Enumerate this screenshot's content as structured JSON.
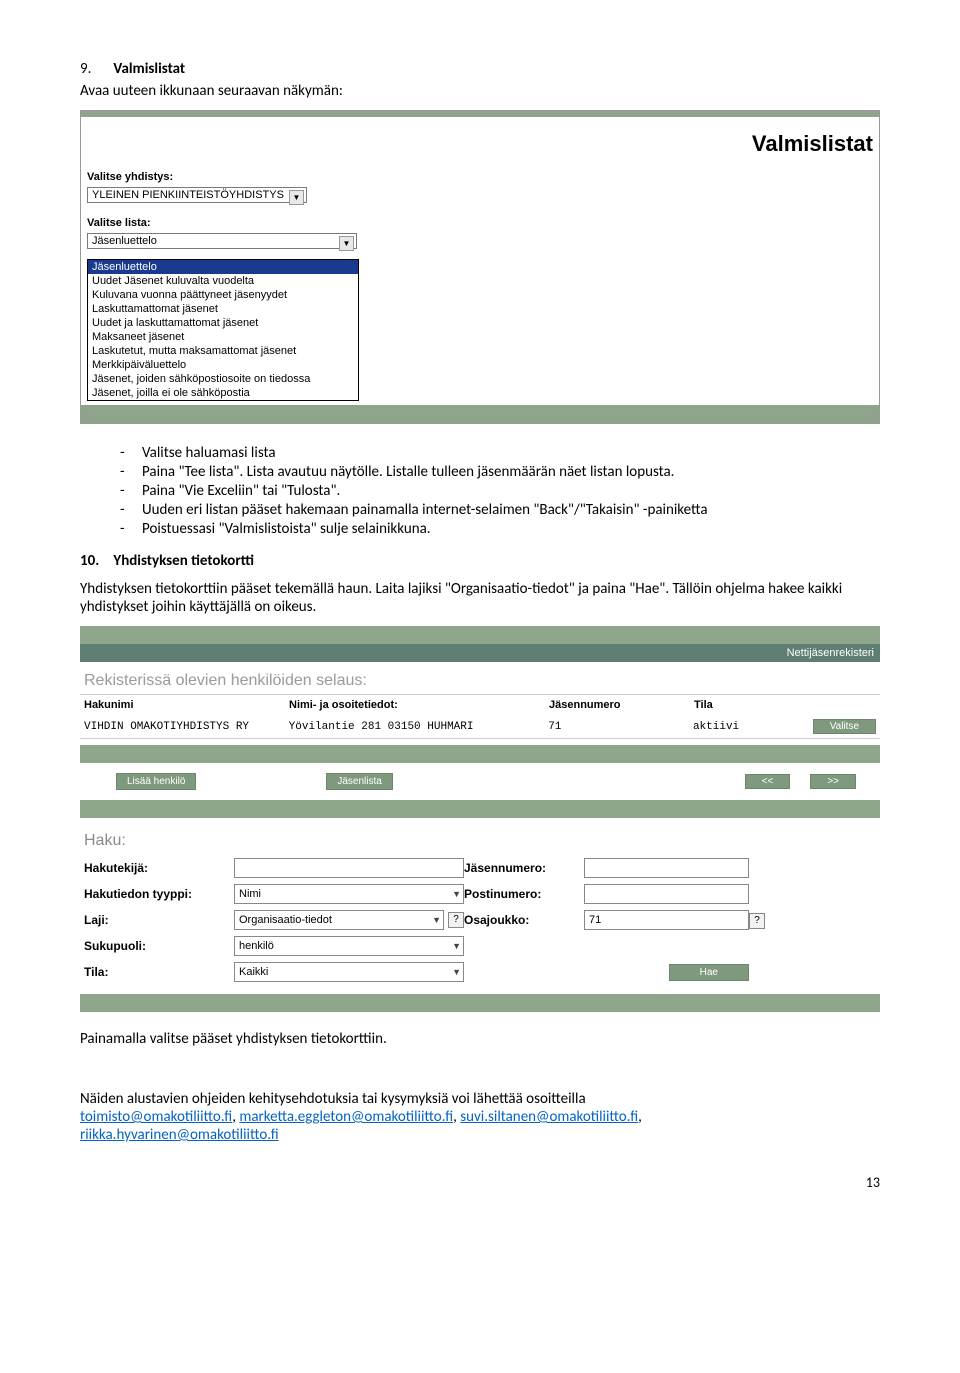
{
  "section9": {
    "number": "9.",
    "title": "Valmislistat",
    "intro": "Avaa uuteen ikkunaan seuraavan näkymän:"
  },
  "shot1": {
    "title": "Valmislistat",
    "label_yhdistys": "Valitse yhdistys:",
    "yhdistys_value": "YLEINEN PIENKIINTEISTÖYHDISTYS",
    "label_lista": "Valitse lista:",
    "lista_value": "Jäsenluettelo",
    "options": [
      "Jäsenluettelo",
      "Uudet Jäsenet kuluvalta vuodelta",
      "Kuluvana vuonna päättyneet jäsenyydet",
      "Laskuttamattomat jäsenet",
      "Uudet ja laskuttamattomat jäsenet",
      "Maksaneet jäsenet",
      "Laskutetut, mutta maksamattomat jäsenet",
      "Merkkipäiväluettelo",
      "Jäsenet, joiden sähköpostiosoite on tiedossa",
      "Jäsenet, joilla ei ole sähköpostia"
    ]
  },
  "bullets9": [
    "Valitse haluamasi lista",
    "Paina \"Tee lista\". Lista avautuu näytölle. Listalle tulleen jäsenmäärän näet listan lopusta.",
    "Paina \"Vie Exceliin\" tai \"Tulosta\".",
    "Uuden eri listan pääset hakemaan painamalla internet-selaimen \"Back\"/\"Takaisin\" -painiketta",
    "Poistuessasi \"Valmislistoista\" sulje selainikkuna."
  ],
  "section10": {
    "number": "10.",
    "title": "Yhdistyksen tietokortti",
    "para": "Yhdistyksen tietokorttiin pääset tekemällä haun. Laita lajiksi \"Organisaatio-tiedot\" ja paina \"Hae\". Tällöin ohjelma hakee kaikki yhdistykset joihin käyttäjällä on oikeus."
  },
  "shot2": {
    "topright": "Nettijäsenrekisteri",
    "section_title": "Rekisterissä olevien henkilöiden selaus:",
    "headers": {
      "hakunimi": "Hakunimi",
      "nimi_osoite": "Nimi- ja osoitetiedot:",
      "jasennumero": "Jäsennumero",
      "tila": "Tila"
    },
    "row": {
      "hakunimi": "VIHDIN OMAKOTIYHDISTYS RY",
      "nimi_osoite": "Yövilantie 281 03150 HUHMARI",
      "jasennumero": "71",
      "tila": "aktiivi"
    },
    "buttons": {
      "valitse": "Valitse",
      "lisaa": "Lisää henkilö",
      "jasenlista": "Jäsenlista",
      "prev": "<<",
      "next": ">>",
      "hae": "Hae"
    },
    "haku_title": "Haku:",
    "form": {
      "hakutekija_lbl": "Hakutekijä:",
      "jasennumero_lbl": "Jäsennumero:",
      "hakutiedon_lbl": "Hakutiedon tyyppi:",
      "hakutiedon_val": "Nimi",
      "postinumero_lbl": "Postinumero:",
      "laji_lbl": "Laji:",
      "laji_val": "Organisaatio-tiedot",
      "osajoukko_lbl": "Osajoukko:",
      "osajoukko_val": "71",
      "sukupuoli_lbl": "Sukupuoli:",
      "sukupuoli_val": "henkilö",
      "tila_lbl": "Tila:",
      "tila_val": "Kaikki"
    }
  },
  "after_shot2": "Painamalla valitse pääset yhdistyksen tietokorttiin.",
  "footer": {
    "text1": "Näiden alustavien ohjeiden kehitysehdotuksia tai kysymyksiä voi lähettää osoitteilla",
    "link1": "toimisto@omakotiliitto.fi",
    "link2": "marketta.eggleton@omakotiliitto.fi",
    "link3": "suvi.siltanen@omakotiliitto.fi",
    "link4": "riikka.hyvarinen@omakotiliitto.fi",
    "sep": ", "
  },
  "pagenum": "13"
}
